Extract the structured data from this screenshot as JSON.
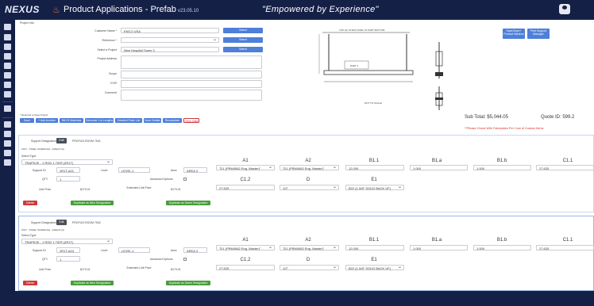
{
  "header": {
    "logo": "NEXUS",
    "app_title": "Product Applications - Prefab",
    "version": "v23.05.10",
    "tagline": "\"Empowered by Experience\""
  },
  "project": {
    "section_label": "Project Info",
    "customer_name_label": "Customer Name *",
    "customer_name_value": "ENCO USA",
    "reference_label": "Reference *",
    "select_project_label": "Select a Project",
    "select_project_value": "New Hospital Tower 3",
    "project_address_label": "Project Address",
    "scope_label": "Scope",
    "eor_label": "EOR",
    "comment_label": "Comment",
    "select_btn": "Select",
    "right_btn_1": "Save/Save+ Product Window",
    "right_btn_2": "Print Support Manager",
    "drawing_caption_top": "TOP OF STRUCTURE TO PART BOTTOM",
    "drawing_caption_bottom": "NOT TO SCALE",
    "drawing_part": "PART 1"
  },
  "toolbar": {
    "required_note": "* Required to Save Project",
    "buttons": [
      "Save",
      "+ Add Another",
      "Bill Of Materials",
      "Generate Cut Lengths",
      "Detailed Parts List",
      "Save Details",
      "Recalculate",
      "Clear Data"
    ],
    "subtotal": "Sub Total: $5,044.05",
    "quote_id": "Quote ID: 599.2",
    "warning": "**Please Check With Fabrication Per Cost of Custom Items"
  },
  "supports": [
    {
      "designation_label": "Support Designation",
      "edit_label": "Edit",
      "designation_value": "PROFILE-ROOM 7541",
      "subtitle": "UNIT - STEEL SCHEDULE - AREA 8 (A)",
      "select_type_label": "Select Type:",
      "select_type_value": "TRAPEZE - 1 ROD 1 TIER (2R1T)",
      "support_id_label": "Support ID",
      "support_id_value": "2R1T-A21",
      "level_label": "Level",
      "level_value": "LEVEL 1",
      "area_label": "Area",
      "area_value": "AREA 3",
      "qty_label": "QTY",
      "qty_value": "1",
      "advanced_label": "Advanced Options",
      "unit_price_label": "Unit Price",
      "unit_price_value": "$179.01",
      "extended_label": "Extended Unit Price",
      "extended_value": "$179.01",
      "delete_btn": "Delete",
      "dup_new_btn": "Duplicate as New Designation",
      "dup_same_btn": "Duplicate as Same Designation",
      "fields": [
        {
          "label": "A1",
          "value": "\"D1 (PRM4562 Eng. Master)\""
        },
        {
          "label": "A2",
          "value": "\"D1 (PRM4562 Eng. Master)\""
        },
        {
          "label": "B1.1",
          "value": "12.000"
        },
        {
          "label": "B1.a",
          "value": "1.000"
        },
        {
          "label": "B1.b",
          "value": "1.000"
        },
        {
          "label": "C1.1",
          "value": "27.625"
        },
        {
          "label": "C1.2",
          "value": "27.625"
        },
        {
          "label": "D",
          "value": "1/2\""
        },
        {
          "label": "E1",
          "value": "B22 (1-5/8\" SOLID BACK UF)"
        }
      ]
    },
    {
      "designation_label": "Support Designation",
      "edit_label": "Edit",
      "designation_value": "PROFILE-ROOM 7542",
      "subtitle": "UNIT - STEEL SCHEDULE - AREA 8 (A)",
      "select_type_label": "Select Type:",
      "select_type_value": "TRAPEZE - 1 ROD 1 TIER (2R1T)",
      "support_id_label": "Support ID",
      "support_id_value": "2R1T-A24",
      "level_label": "Level",
      "level_value": "LEVEL 1",
      "area_label": "Area",
      "area_value": "AREA 3",
      "qty_label": "QTY",
      "qty_value": "1",
      "advanced_label": "Advanced Options",
      "unit_price_label": "Unit Price",
      "unit_price_value": "$179.01",
      "extended_label": "Extended Unit Price",
      "extended_value": "$179.01",
      "delete_btn": "Delete",
      "dup_new_btn": "Duplicate as New Designation",
      "dup_same_btn": "Duplicate as Same Designation",
      "fields": [
        {
          "label": "A1",
          "value": "\"D1 (PRM4562 Eng. Master)\""
        },
        {
          "label": "A2",
          "value": "\"D1 (PRM4562 Eng. Master)\""
        },
        {
          "label": "B1.1",
          "value": "12.000"
        },
        {
          "label": "B1.a",
          "value": "1.000"
        },
        {
          "label": "B1.b",
          "value": "1.000"
        },
        {
          "label": "C1.1",
          "value": "27.625"
        },
        {
          "label": "C1.2",
          "value": "27.625"
        },
        {
          "label": "D",
          "value": "1/2\""
        },
        {
          "label": "E1",
          "value": "B22 (1-5/8\" SOLID BACK UF)"
        }
      ]
    }
  ],
  "colors": {
    "navy": "#152047",
    "accent_blue": "#4f7fd8",
    "green": "#4a9c3e",
    "red": "#cf3939",
    "warning": "#d9302c"
  }
}
